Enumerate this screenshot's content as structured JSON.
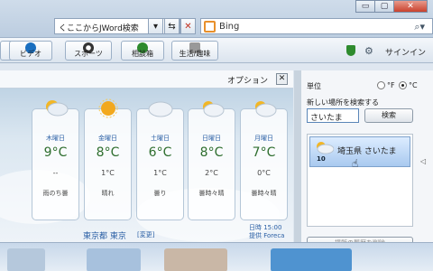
{
  "window": {
    "minimize": "▭",
    "restore": "▢",
    "close": "✕"
  },
  "address": {
    "text": "くここからJWord検索",
    "dropdown": "▾",
    "refresh": "⇆",
    "stop": "✕"
  },
  "search": {
    "engine": "Bing",
    "icon": "search-icon"
  },
  "toolbar": {
    "items": [
      {
        "label": "ビデオ",
        "icon_color": "#1a6fc0"
      },
      {
        "label": "スポーツ",
        "icon_color": "#333333"
      },
      {
        "label": "相談箱",
        "icon_color": "#2e8b2e"
      },
      {
        "label": "生活/趣味",
        "icon_color": "#777777"
      }
    ],
    "signin": "サインイン"
  },
  "weather": {
    "options_label": "オプション",
    "close": "✕",
    "days": [
      {
        "day": "木曜日",
        "high": "9°C",
        "low": "--",
        "cond": "雨のち曇",
        "icon": "rain-cloud-icon"
      },
      {
        "day": "金曜日",
        "high": "8°C",
        "low": "1°C",
        "cond": "晴れ",
        "icon": "sun-icon"
      },
      {
        "day": "土曜日",
        "high": "6°C",
        "low": "1°C",
        "cond": "曇り",
        "icon": "cloud-icon"
      },
      {
        "day": "日曜日",
        "high": "8°C",
        "low": "2°C",
        "cond": "曇時々晴",
        "icon": "sun-cloud-icon"
      },
      {
        "day": "月曜日",
        "high": "7°C",
        "low": "0°C",
        "cond": "曇時々晴",
        "icon": "sun-cloud-icon"
      }
    ],
    "location": "東京都 東京",
    "change": "[変更]",
    "time_line1": "日時 15:00",
    "time_line2": "提供 Foreca"
  },
  "settings": {
    "unit_label": "単位",
    "unit_f": "°F",
    "unit_c": "°C",
    "selected_unit": "C",
    "new_location_label": "新しい場所を検索する",
    "input_value": "さいたま",
    "search_button": "検索",
    "result_label": "埼玉県 さいたま",
    "result_temp": "10",
    "clear_history": "場所の履歴を削除"
  }
}
